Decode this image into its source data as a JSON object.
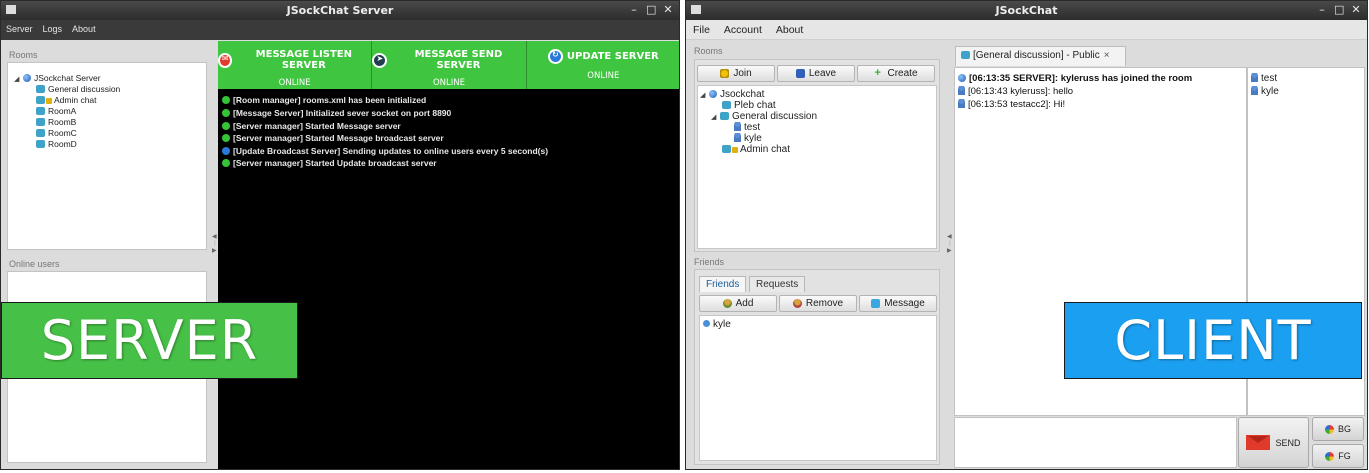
{
  "server": {
    "title": "JSockChat Server",
    "menu": [
      "Server",
      "Logs",
      "About"
    ],
    "rooms_label": "Rooms",
    "online_users_label": "Online users",
    "tree": {
      "root": "JSockchat Server",
      "rooms": [
        "General discussion",
        "Admin chat",
        "RoomA",
        "RoomB",
        "RoomC",
        "RoomD"
      ]
    },
    "status": [
      {
        "name": "MESSAGE LISTEN SERVER",
        "state": "ONLINE",
        "icon": "mail-icon"
      },
      {
        "name": "MESSAGE SEND SERVER",
        "state": "ONLINE",
        "icon": "send-icon"
      },
      {
        "name": "UPDATE SERVER",
        "state": "ONLINE",
        "icon": "refresh-icon"
      }
    ],
    "log": [
      "[Room manager] rooms.xml has been initialized",
      "[Message Server] Initialized sever socket on port 8890",
      "[Server manager] Started Message server",
      "[Server manager] Started Message broadcast server",
      "[Update Broadcast Server] Sending updates to online users every 5 second(s)",
      "[Server manager] Started Update broadcast server"
    ],
    "overlay": "SERVER"
  },
  "client": {
    "title": "JSockChat",
    "menu": [
      "File",
      "Account",
      "About"
    ],
    "rooms_label": "Rooms",
    "room_buttons": [
      "Join",
      "Leave",
      "Create"
    ],
    "tree": {
      "root": "Jsockchat",
      "pleb": "Pleb chat",
      "general": "General discussion",
      "general_users": [
        "test",
        "kyle"
      ],
      "admin": "Admin chat"
    },
    "friends_label": "Friends",
    "friends_tabs": [
      "Friends",
      "Requests"
    ],
    "friend_buttons": [
      "Add",
      "Remove",
      "Message"
    ],
    "friends": [
      "kyle"
    ],
    "chat_tab": "[General discussion] - Public",
    "chat_tab_close": "×",
    "messages": [
      "[06:13:35 SERVER]: kyleruss has joined the room",
      "[06:13:43 kyleruss]: hello",
      "[06:13:53 testacc2]: Hi!"
    ],
    "users": [
      "test",
      "kyle"
    ],
    "send_label": "SEND",
    "bg_label": "BG",
    "fg_label": "FG",
    "overlay": "CLIENT"
  },
  "window_controls": [
    "–",
    "□",
    "✕"
  ],
  "colors": {
    "server_status_green": "#3fc53f",
    "server_overlay_green": "#46c046",
    "client_overlay_blue": "#1b9ff0",
    "log_background": "#000000"
  }
}
